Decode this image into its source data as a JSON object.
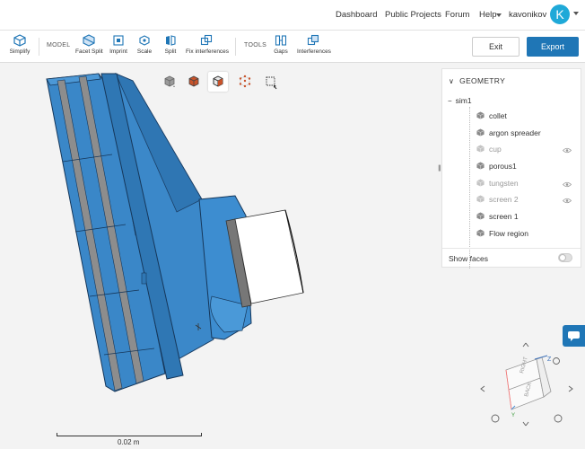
{
  "nav": {
    "dashboard": "Dashboard",
    "public_projects": "Public Projects",
    "forum": "Forum",
    "help": "Help",
    "username": "kavonikov",
    "avatar_letter": "K"
  },
  "toolbar": {
    "simplify": "Simplify",
    "model_label": "MODEL",
    "facet_split": "Facet Split",
    "imprint": "Imprint",
    "scale": "Scale",
    "split": "Split",
    "fix_interferences": "Fix interferences",
    "tools_label": "TOOLS",
    "gaps": "Gaps",
    "interferences": "Interferences",
    "exit": "Exit",
    "export": "Export"
  },
  "geometry": {
    "header": "GEOMETRY",
    "sim_name": "sim1",
    "items": [
      {
        "label": "collet",
        "hidden": false
      },
      {
        "label": "argon spreader",
        "hidden": false
      },
      {
        "label": "cup",
        "hidden": true
      },
      {
        "label": "porous1",
        "hidden": false
      },
      {
        "label": "tungsten",
        "hidden": true
      },
      {
        "label": "screen 2",
        "hidden": true
      },
      {
        "label": "screen 1",
        "hidden": false
      },
      {
        "label": "Flow region",
        "hidden": false
      }
    ],
    "show_faces": "Show faces"
  },
  "orientation_cube": {
    "axis_z": "Z",
    "axis_y": "Y",
    "face_top": "RIGHT",
    "face_bottom": "BACK"
  },
  "scale_bar": {
    "label": "0.02 m"
  },
  "colors": {
    "accent": "#1f76b6",
    "model_blue": "#3a87c8",
    "model_dark": "#1b4f80",
    "avatar": "#1fa9d8"
  }
}
